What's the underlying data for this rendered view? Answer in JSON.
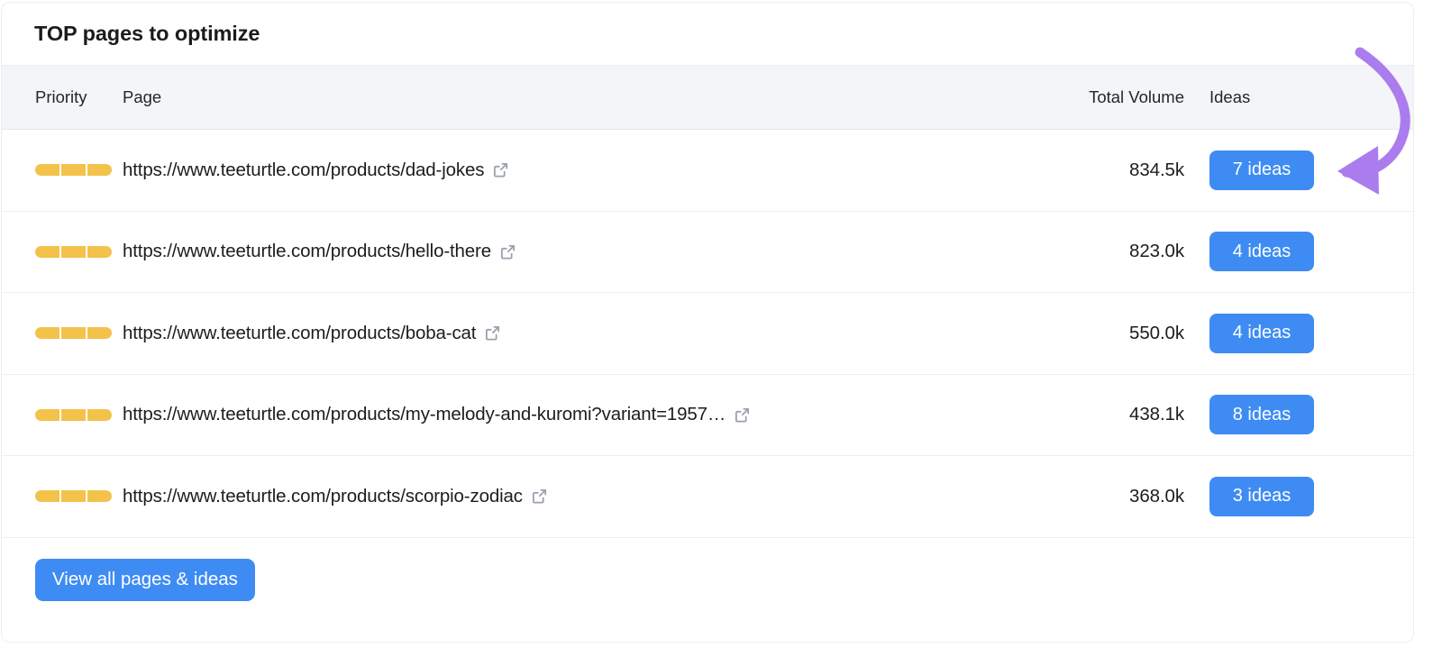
{
  "card": {
    "title": "TOP pages to optimize"
  },
  "table": {
    "columns": {
      "priority": "Priority",
      "page": "Page",
      "volume": "Total Volume",
      "ideas": "Ideas"
    },
    "rows": [
      {
        "priority_segments": 3,
        "priority_color": "#f3c24b",
        "url": "https://www.teeturtle.com/products/dad-jokes",
        "external_link_icon": "external-link-icon",
        "volume": "834.5k",
        "ideas": "7 ideas"
      },
      {
        "priority_segments": 3,
        "priority_color": "#f3c24b",
        "url": "https://www.teeturtle.com/products/hello-there",
        "external_link_icon": "external-link-icon",
        "volume": "823.0k",
        "ideas": "4 ideas"
      },
      {
        "priority_segments": 3,
        "priority_color": "#f3c24b",
        "url": "https://www.teeturtle.com/products/boba-cat",
        "external_link_icon": "external-link-icon",
        "volume": "550.0k",
        "ideas": "4 ideas"
      },
      {
        "priority_segments": 3,
        "priority_color": "#f3c24b",
        "url": "https://www.teeturtle.com/products/my-melody-and-kuromi?variant=1957…",
        "external_link_icon": "external-link-icon",
        "volume": "438.1k",
        "ideas": "8 ideas"
      },
      {
        "priority_segments": 3,
        "priority_color": "#f3c24b",
        "url": "https://www.teeturtle.com/products/scorpio-zodiac",
        "external_link_icon": "external-link-icon",
        "volume": "368.0k",
        "ideas": "3 ideas"
      }
    ]
  },
  "footer": {
    "cta_label": "View all pages & ideas"
  },
  "annotation": {
    "type": "curved-arrow",
    "color": "#ab7ced",
    "points_to": "7 ideas"
  },
  "colors": {
    "accent_blue": "#3e8cf3",
    "priority_amber": "#f3c24b",
    "annotation_purple": "#ab7ced",
    "header_bg": "#f4f5f8",
    "border": "#eceef2",
    "text": "#1b1d21"
  }
}
